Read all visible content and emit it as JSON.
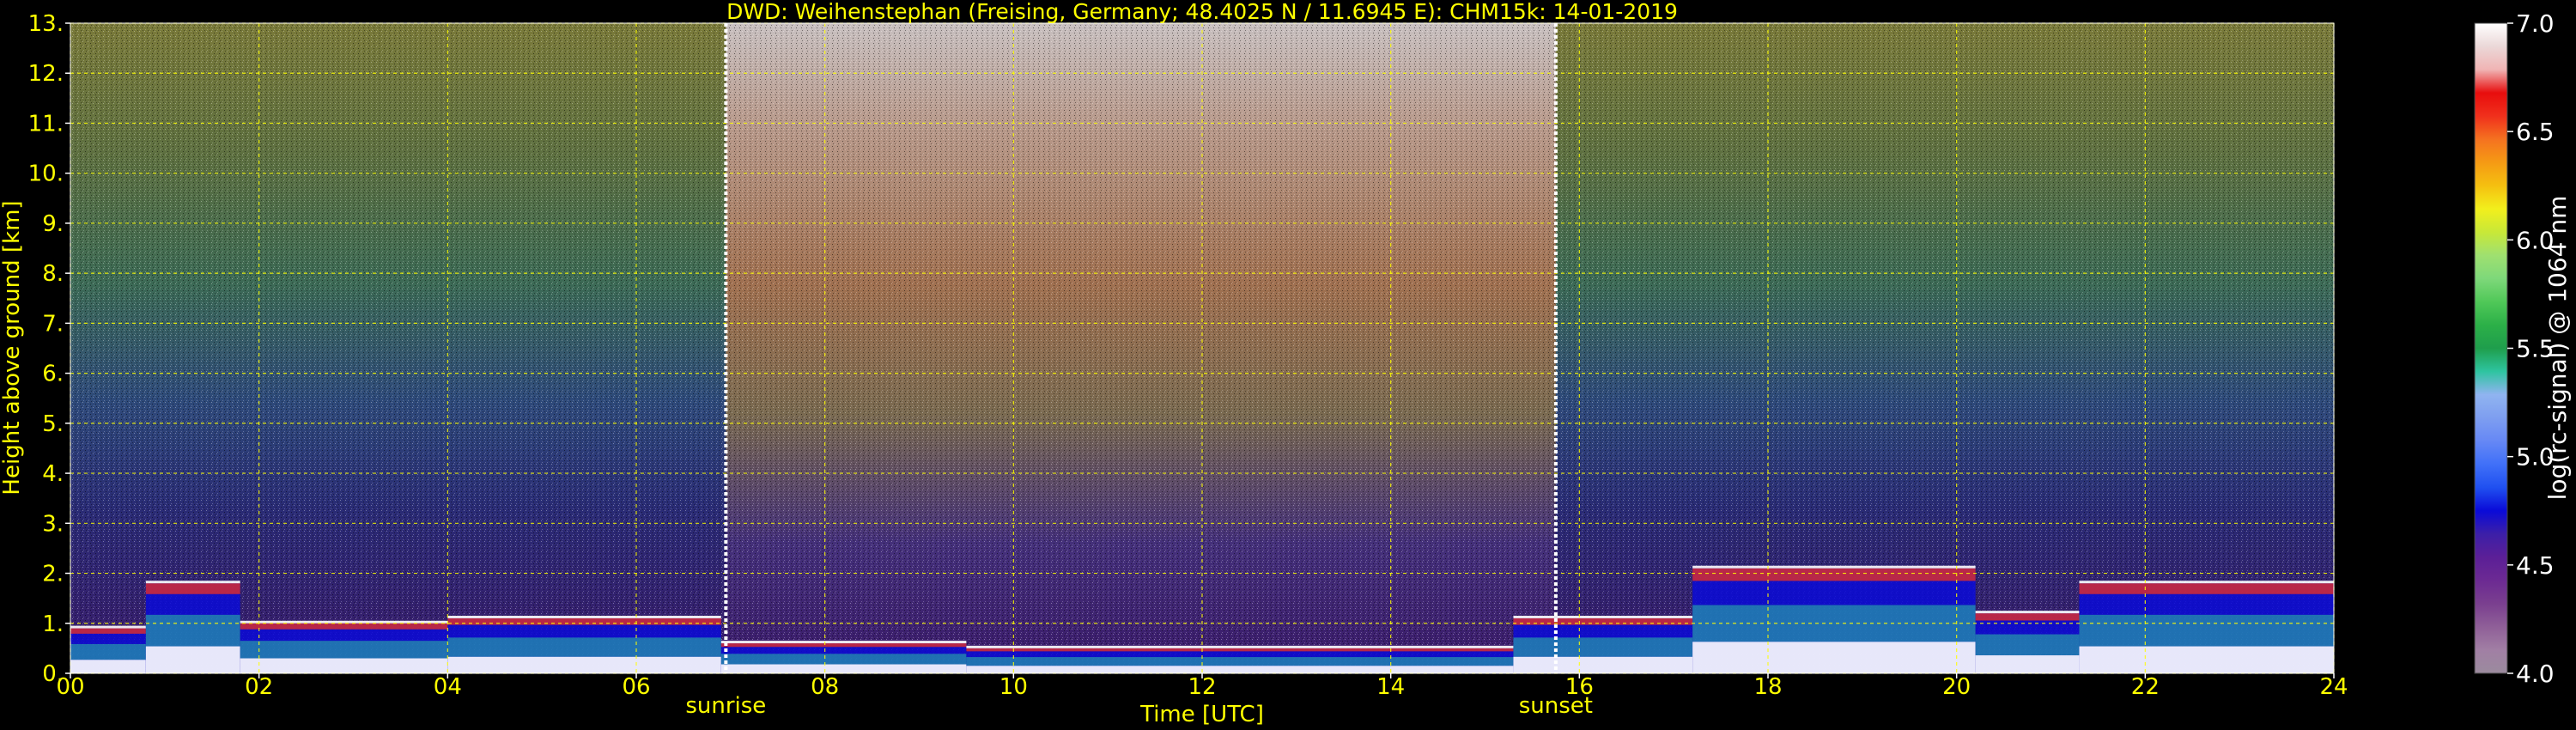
{
  "chart_data": {
    "type": "heatmap",
    "title": "DWD: Weihenstephan (Freising, Germany; 48.4025 N / 11.6945 E):    CHM15k: 14-01-2019",
    "xlabel": "Time [UTC]",
    "ylabel": "Height above ground [km]",
    "xlim": [
      0,
      24
    ],
    "ylim": [
      0,
      13
    ],
    "x_ticks": [
      "00",
      "02",
      "04",
      "06",
      "08",
      "10",
      "12",
      "14",
      "16",
      "18",
      "20",
      "22",
      "24"
    ],
    "y_ticks": [
      "0.",
      "1.",
      "2.",
      "3.",
      "4.",
      "5.",
      "6.",
      "7.",
      "8.",
      "9.",
      "10.",
      "11.",
      "12.",
      "13."
    ],
    "grid": true,
    "markers": [
      {
        "label": "sunrise",
        "time": 6.95
      },
      {
        "label": "sunset",
        "time": 15.75
      }
    ],
    "colorbar": {
      "label": "log(rc-signal) @ 1064 nm",
      "range": [
        4.0,
        7.0
      ],
      "ticks": [
        "4.0",
        "4.5",
        "5.0",
        "5.5",
        "6.0",
        "6.5",
        "7.0"
      ],
      "colors": [
        "#9b8b9e",
        "#a17fa4",
        "#8f5f98",
        "#7a3f8f",
        "#6c2a93",
        "#5b1f97",
        "#3c1fa8",
        "#0a0ad8",
        "#2050f0",
        "#4070f8",
        "#6688f5",
        "#7e9ef0",
        "#90b4f0",
        "#2ec4a0",
        "#1f9e4c",
        "#2cb048",
        "#50c858",
        "#7ed87a",
        "#9fe070",
        "#c8e838",
        "#f2ef1c",
        "#f5c010",
        "#f59a14",
        "#f57220",
        "#f0301c",
        "#e80d0d",
        "#f0b4b4",
        "#ebd8d8",
        "#ffffff"
      ]
    },
    "boundary_layer": [
      {
        "start": 0.0,
        "end": 0.8,
        "top_km": 0.9
      },
      {
        "start": 0.8,
        "end": 1.8,
        "top_km": 1.8
      },
      {
        "start": 1.8,
        "end": 4.0,
        "top_km": 1.0
      },
      {
        "start": 4.0,
        "end": 6.9,
        "top_km": 1.1
      },
      {
        "start": 6.9,
        "end": 9.5,
        "top_km": 0.6
      },
      {
        "start": 9.5,
        "end": 15.3,
        "top_km": 0.5
      },
      {
        "start": 15.3,
        "end": 17.2,
        "top_km": 1.1
      },
      {
        "start": 17.2,
        "end": 20.2,
        "top_km": 2.1
      },
      {
        "start": 20.2,
        "end": 21.3,
        "top_km": 1.2
      },
      {
        "start": 21.3,
        "end": 24.0,
        "top_km": 1.8
      }
    ]
  }
}
